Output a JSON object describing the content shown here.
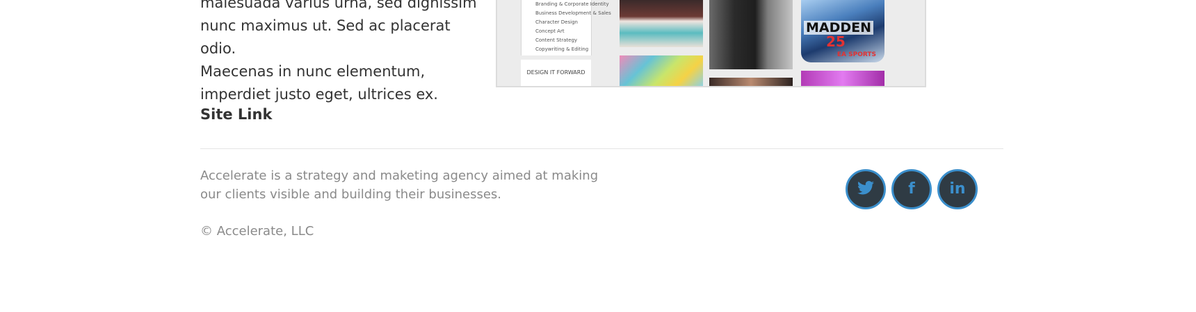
{
  "project": {
    "description_lines": [
      "malesuada varius urna, sed dignissim",
      "nunc maximus ut. Sed ac placerat odio.",
      "Maecenas in nunc elementum,",
      "imperdiet justo eget, ultrices ex."
    ],
    "site_link_label": "Site Link",
    "screenshot": {
      "nav_items": [
        "Branding & Corporate Identity",
        "Business Development & Sales",
        "Character Design",
        "Concept Art",
        "Content Strategy",
        "Copywriting & Editing"
      ],
      "logo_text": "DESIGN IT FORWARD",
      "game_title": "MADDEN",
      "game_number": "25",
      "game_publisher": "EA SPORTS"
    }
  },
  "footer": {
    "tagline": "Accelerate is a strategy and maketing agency aimed at making our clients visible and building their businesses.",
    "copyright": "© Accelerate, LLC",
    "social": [
      {
        "name": "twitter",
        "icon": "twitter-icon"
      },
      {
        "name": "facebook",
        "icon": "facebook-icon",
        "glyph": "f"
      },
      {
        "name": "linkedin",
        "icon": "linkedin-icon",
        "glyph": "in"
      }
    ],
    "colors": {
      "social_ring": "#3b8fcc",
      "social_fill": "#2f3b44"
    }
  }
}
